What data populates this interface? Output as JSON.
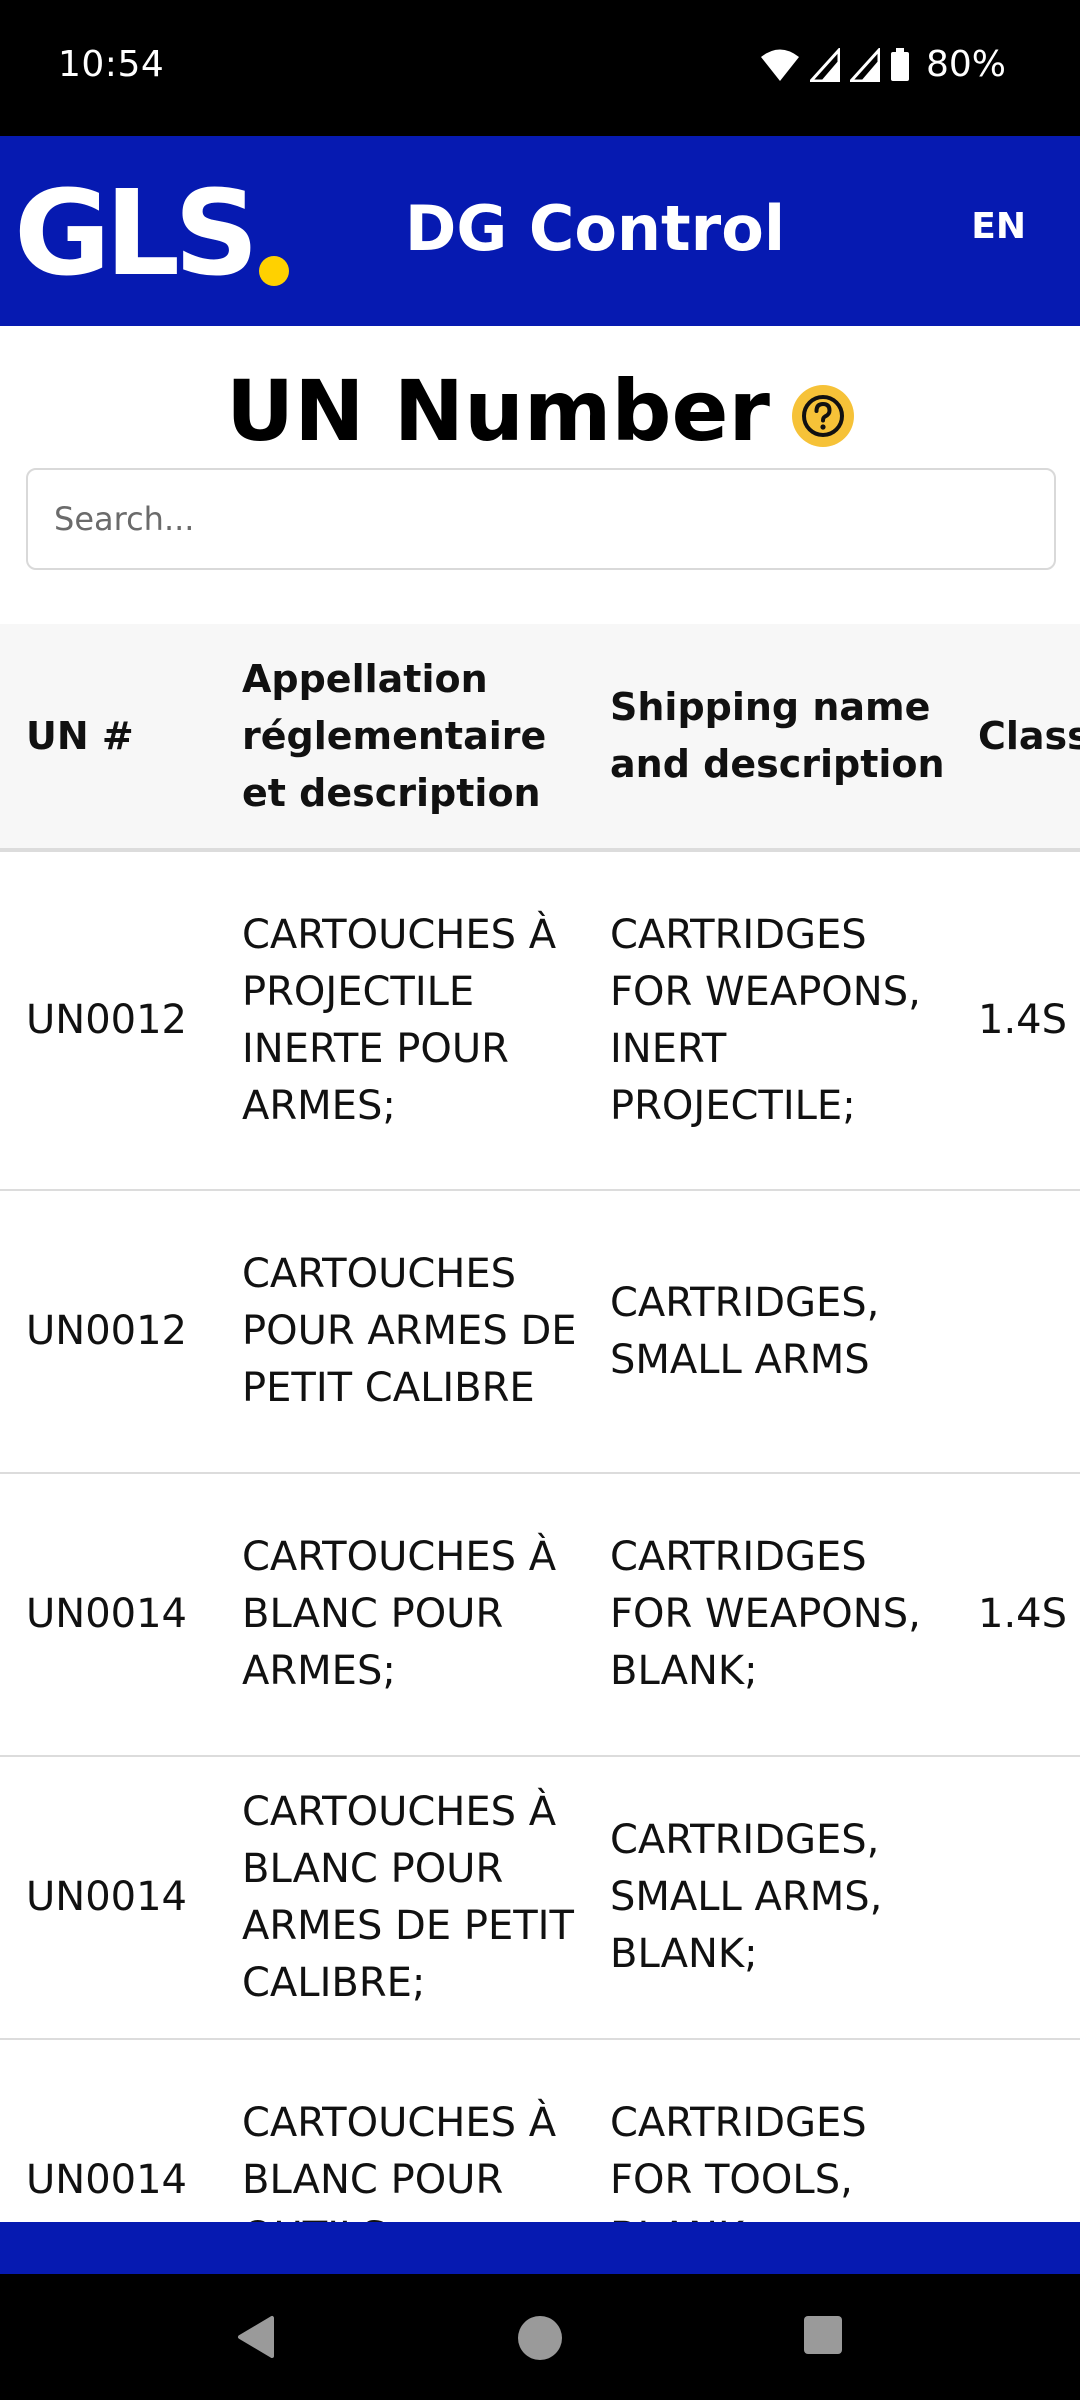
{
  "status_bar": {
    "time": "10:54",
    "battery": "80%"
  },
  "header": {
    "logo_text": "GLS",
    "title": "DG Control",
    "language": "EN"
  },
  "page": {
    "title": "UN Number",
    "help_icon": "help-icon"
  },
  "search": {
    "placeholder": "Search...",
    "value": ""
  },
  "table": {
    "headers": [
      "UN #",
      "Appellation réglementaire et description",
      "Shipping name and description",
      "Class"
    ],
    "rows": [
      [
        "UN0012",
        "CARTOUCHES À PROJECTILE INERTE POUR ARMES;",
        "CARTRIDGES FOR WEAPONS, INERT PROJECTILE;",
        "1.4S"
      ],
      [
        "UN0012",
        "CARTOUCHES POUR ARMES DE PETIT CALIBRE",
        "CARTRIDGES, SMALL ARMS",
        ""
      ],
      [
        "UN0014",
        "CARTOUCHES À BLANC POUR ARMES;",
        "CARTRIDGES FOR WEAPONS, BLANK;",
        "1.4S"
      ],
      [
        "UN0014",
        "CARTOUCHES À BLANC POUR ARMES DE PETIT CALIBRE;",
        "CARTRIDGES, SMALL ARMS, BLANK;",
        ""
      ],
      [
        "UN0014",
        "CARTOUCHES À BLANC POUR OUTILS",
        "CARTRIDGES FOR TOOLS, BLANK",
        ""
      ]
    ]
  },
  "colors": {
    "brand_blue": "#061ab1",
    "brand_yellow": "#ffd100",
    "help_yellow": "#f6c238"
  },
  "nav": {
    "back_icon": "back-triangle-icon",
    "home_icon": "home-circle-icon",
    "recents_icon": "recents-square-icon"
  }
}
